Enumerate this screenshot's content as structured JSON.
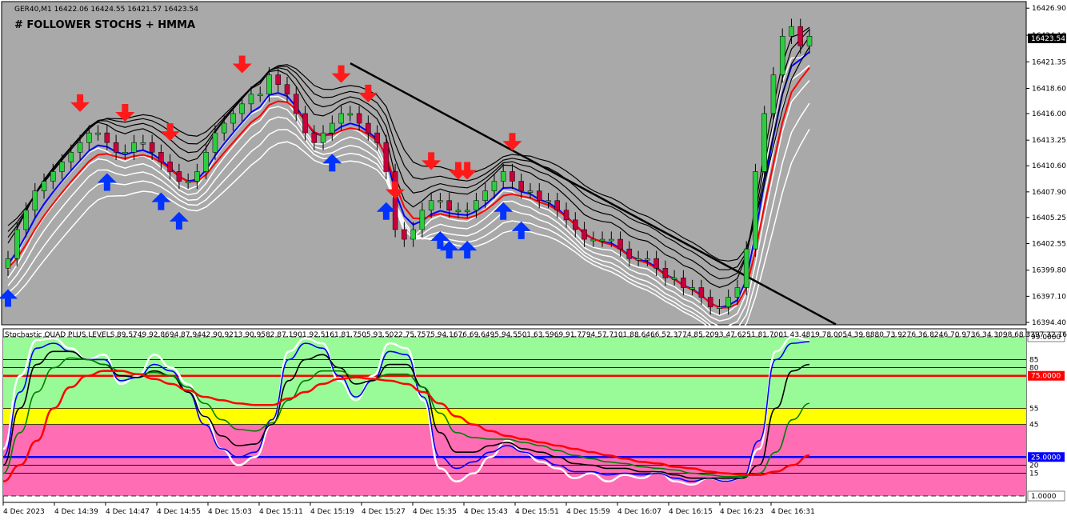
{
  "window": {
    "symbol_info": "GER40,M1  16422.06 16424.55 16421.57 16423.54",
    "indicator_title": "# FOLLOWER STOCHS + HMMA",
    "current_price_label": "16423.54"
  },
  "colors": {
    "main_bg": "#a9a9a9",
    "bull_candle": "#2ecc40",
    "bear_candle": "#c8003c",
    "up_arrow": "#0033ff",
    "down_arrow": "#ff1a1a",
    "zone_green": "#98fb98",
    "zone_yellow": "#ffff00",
    "zone_pink": "#ff6eb4",
    "level_75": "#ff0000",
    "level_25": "#0000ff"
  },
  "chart_data": [
    {
      "type": "candlestick",
      "title": "GER40,M1",
      "ylim": [
        16394.4,
        16427.0
      ],
      "y_ticks": [
        "16426.90",
        "16424.10",
        "16421.35",
        "16418.60",
        "16416.00",
        "16413.25",
        "16410.60",
        "16407.90",
        "16405.25",
        "16402.55",
        "16399.80",
        "16397.10",
        "16394.40"
      ],
      "last_price": 16423.54,
      "close_path": [
        16401,
        16404,
        16406,
        16408,
        16409,
        16410,
        16411,
        16412,
        16413,
        16414,
        16414,
        16413,
        16412,
        16412,
        16413,
        16413,
        16412,
        16411,
        16410,
        16409,
        16409,
        16410,
        16412,
        16414,
        16415,
        16416,
        16417,
        16418,
        16418,
        16420,
        16419,
        16418,
        16416,
        16414,
        16413,
        16414,
        16415,
        16416,
        16416,
        16415,
        16414,
        16413,
        16410,
        16404,
        16403,
        16404,
        16406,
        16407,
        16407,
        16406,
        16406,
        16406,
        16407,
        16408,
        16409,
        16410,
        16409,
        16408,
        16408,
        16407,
        16407,
        16406,
        16405,
        16404,
        16403,
        16403,
        16403,
        16403,
        16402,
        16401,
        16401,
        16401,
        16400,
        16399,
        16399,
        16398,
        16398,
        16397,
        16396,
        16396,
        16397,
        16398,
        16402,
        16410,
        16416,
        16420,
        16424,
        16425,
        16423,
        16424
      ],
      "sell_arrow_bars": [
        8,
        13,
        18,
        26,
        37,
        40,
        43,
        47,
        50,
        51,
        56
      ],
      "buy_arrow_bars": [
        0,
        11,
        17,
        19,
        36,
        42,
        48,
        49,
        51,
        55,
        57
      ],
      "trend_line": {
        "from_price": 16421.2,
        "to_price": 16394.2
      }
    },
    {
      "type": "line",
      "title": "Stochastic QUAD PLUS LEVELS",
      "legend_values": "89.5749 92.8694 87.9442 90.9213 90.9582 87.1901 92.5161 81.7505 93.5022 75.7575 94.1676 69.6495 94.5501 63.5969 91.7794 57.7101 88.6466 52.3774 85.2093 47.6251 81.7001 43.4819 78.0054 39.8880 73.9276 36.8246 70.9736 34.3098 68.3397 32.1612 65.9478 30.3187",
      "ylim": [
        0,
        100
      ],
      "y_tick_labels": [
        "99.0000",
        "85",
        "80",
        "75.0000",
        "55",
        "45",
        "25.0000",
        "20",
        "15",
        "1.0000"
      ],
      "levels": [
        99,
        85,
        80,
        75,
        55,
        45,
        25,
        20,
        15,
        1
      ],
      "x_tick_labels": [
        "4 Dec 2023",
        "4 Dec 14:39",
        "4 Dec 14:47",
        "4 Dec 14:55",
        "4 Dec 15:03",
        "4 Dec 15:11",
        "4 Dec 15:19",
        "4 Dec 15:27",
        "4 Dec 15:35",
        "4 Dec 15:43",
        "4 Dec 15:51",
        "4 Dec 15:59",
        "4 Dec 16:07",
        "4 Dec 16:15",
        "4 Dec 16:23",
        "4 Dec 16:31"
      ],
      "series": [
        {
          "color": "#ffffff",
          "values": [
            30,
            75,
            97,
            98,
            92,
            85,
            88,
            70,
            75,
            88,
            80,
            70,
            50,
            30,
            20,
            25,
            45,
            90,
            98,
            95,
            72,
            60,
            75,
            95,
            92,
            60,
            18,
            10,
            15,
            25,
            35,
            28,
            22,
            18,
            12,
            15,
            10,
            14,
            12,
            16,
            10,
            8,
            12,
            10,
            12,
            30,
            90,
            99,
            97
          ]
        },
        {
          "color": "#0000ff",
          "values": [
            25,
            65,
            92,
            95,
            90,
            85,
            85,
            72,
            74,
            82,
            78,
            65,
            45,
            30,
            25,
            28,
            48,
            85,
            95,
            92,
            75,
            62,
            72,
            90,
            88,
            62,
            25,
            18,
            22,
            28,
            32,
            28,
            24,
            20,
            16,
            16,
            14,
            15,
            14,
            15,
            12,
            10,
            12,
            10,
            12,
            35,
            85,
            95,
            96
          ]
        },
        {
          "color": "#000000",
          "values": [
            20,
            55,
            82,
            90,
            90,
            85,
            82,
            75,
            74,
            78,
            75,
            65,
            50,
            38,
            32,
            33,
            45,
            72,
            85,
            88,
            80,
            70,
            72,
            82,
            82,
            68,
            40,
            28,
            28,
            32,
            34,
            30,
            28,
            25,
            21,
            20,
            18,
            18,
            16,
            16,
            14,
            12,
            12,
            12,
            12,
            20,
            55,
            78,
            82
          ]
        },
        {
          "color": "#007f00",
          "values": [
            15,
            40,
            65,
            80,
            86,
            85,
            82,
            78,
            76,
            77,
            75,
            68,
            58,
            48,
            42,
            41,
            46,
            60,
            72,
            78,
            78,
            74,
            73,
            76,
            76,
            68,
            52,
            40,
            37,
            36,
            36,
            34,
            32,
            29,
            26,
            24,
            22,
            21,
            19,
            18,
            17,
            15,
            14,
            13,
            13,
            15,
            28,
            48,
            58
          ]
        },
        {
          "color": "#ff0000",
          "values": [
            10,
            20,
            35,
            55,
            68,
            75,
            78,
            78,
            76,
            73,
            70,
            66,
            62,
            60,
            58,
            57,
            57,
            61,
            65,
            70,
            73,
            74,
            73,
            72,
            70,
            65,
            58,
            50,
            45,
            41,
            38,
            36,
            34,
            32,
            30,
            28,
            26,
            24,
            22,
            21,
            19,
            18,
            16,
            15,
            14,
            14,
            16,
            20,
            26
          ]
        }
      ]
    }
  ]
}
